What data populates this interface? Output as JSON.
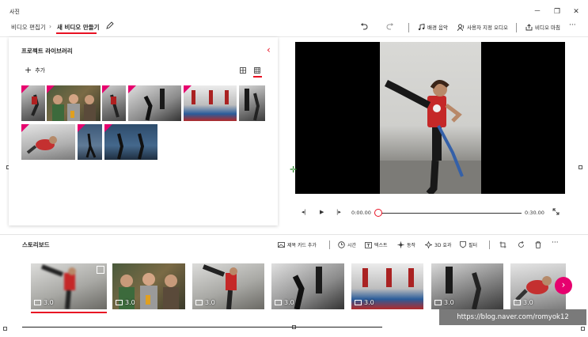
{
  "window": {
    "title": "사진",
    "minimize": "－",
    "maximize": "❐",
    "close": "✕"
  },
  "breadcrumb": {
    "parent": "비디오 편집기",
    "separator": "›",
    "current": "새 비디오 만들기"
  },
  "toolbar": {
    "bg_music": "배경 음악",
    "custom_audio": "사용자 지정 오디오",
    "finish_video": "비디오 마침",
    "more": "···"
  },
  "library": {
    "title": "프로젝트 라이브러리",
    "add_label": "추가",
    "collapse": "‹"
  },
  "playback": {
    "current_time": "0:00.00",
    "total_time": "0:30.00",
    "progress": 0
  },
  "storyboard": {
    "label": "스토리보드",
    "tools": {
      "title_card": "제목 카드 추가",
      "duration": "시간",
      "text": "텍스트",
      "motion": "동작",
      "effects_3d": "3D 효과",
      "filters": "필터"
    },
    "more": "···",
    "clips": [
      {
        "duration": "3.0"
      },
      {
        "duration": "3.0"
      },
      {
        "duration": "3.0"
      },
      {
        "duration": "3.0"
      },
      {
        "duration": "3.0"
      },
      {
        "duration": "3.0"
      },
      {
        "duration": "3.0"
      }
    ],
    "next": "›"
  },
  "watermark": "https://blog.naver.com/romyok12",
  "colors": {
    "accent": "#e6006e",
    "scrub": "#e81123",
    "underline": "#e81123"
  }
}
